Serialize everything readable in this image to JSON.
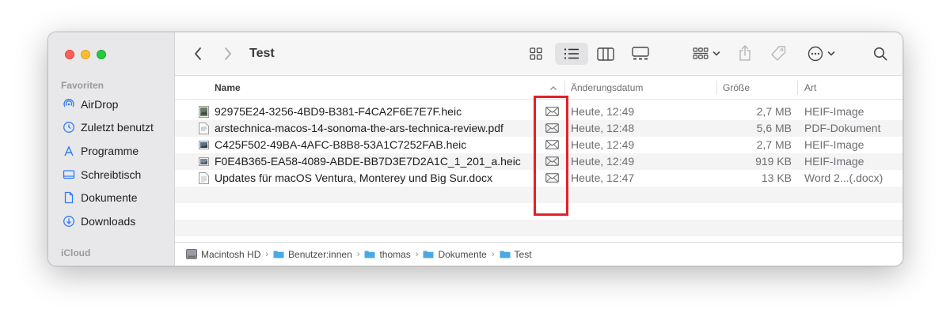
{
  "window": {
    "title": "Test"
  },
  "sidebar": {
    "section_favorites": "Favoriten",
    "section_icloud": "iCloud",
    "items": [
      {
        "label": "AirDrop",
        "icon": "airdrop-icon"
      },
      {
        "label": "Zuletzt benutzt",
        "icon": "clock-icon"
      },
      {
        "label": "Programme",
        "icon": "apps-icon"
      },
      {
        "label": "Schreibtisch",
        "icon": "desktop-icon"
      },
      {
        "label": "Dokumente",
        "icon": "document-icon"
      },
      {
        "label": "Downloads",
        "icon": "download-icon"
      }
    ]
  },
  "columns": {
    "name": "Name",
    "date": "Änderungsdatum",
    "size": "Größe",
    "kind": "Art"
  },
  "files": [
    {
      "name": "92975E24-3256-4BD9-B381-F4CA2F6E7E7F.heic",
      "date": "Heute, 12:49",
      "size": "2,7 MB",
      "kind": "HEIF-Image",
      "icon": "image-file-icon"
    },
    {
      "name": "arstechnica-macos-14-sonoma-the-ars-technica-review.pdf",
      "date": "Heute, 12:48",
      "size": "5,6 MB",
      "kind": "PDF-Dokument",
      "icon": "pdf-file-icon"
    },
    {
      "name": "C425F502-49BA-4AFC-B8B8-53A1C7252FAB.heic",
      "date": "Heute, 12:49",
      "size": "2,7 MB",
      "kind": "HEIF-Image",
      "icon": "image-file-icon"
    },
    {
      "name": "F0E4B365-EA58-4089-ABDE-BB7D3E7D2A1C_1_201_a.heic",
      "date": "Heute, 12:49",
      "size": "919 KB",
      "kind": "HEIF-Image",
      "icon": "image-file-icon"
    },
    {
      "name": "Updates für macOS Ventura, Monterey und Big Sur.docx",
      "date": "Heute, 12:47",
      "size": "13 KB",
      "kind": "Word 2...(.docx)",
      "icon": "docx-file-icon"
    }
  ],
  "pathbar": [
    "Macintosh HD",
    "Benutzer:innen",
    "thomas",
    "Dokumente",
    "Test"
  ],
  "colors": {
    "highlight": "#e3202a",
    "sidebar_bg": "#e8e8ea",
    "folder": "#4aa8e8"
  }
}
